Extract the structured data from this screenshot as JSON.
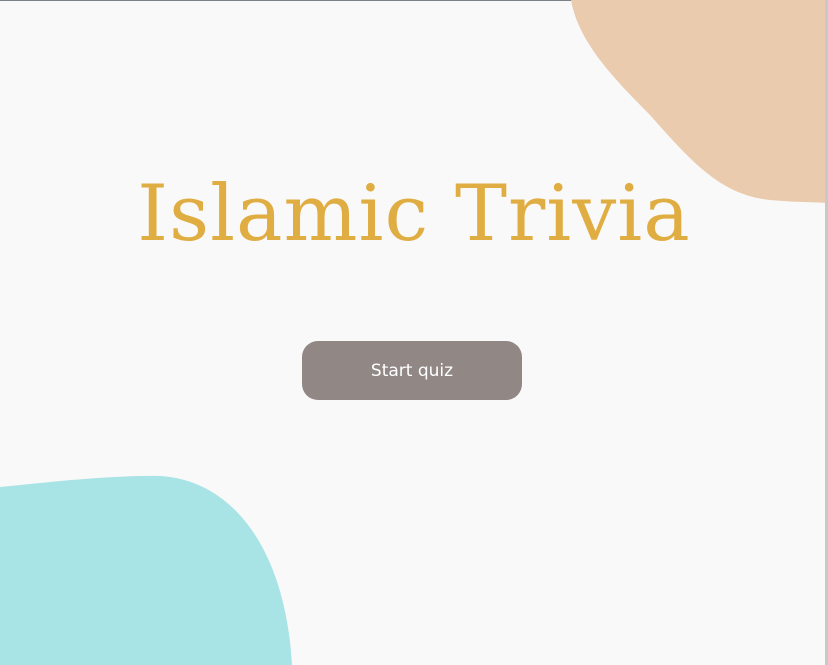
{
  "app": {
    "title": "Islamic Trivia",
    "start_button_label": "Start quiz"
  },
  "colors": {
    "background": "#f9f9f9",
    "title": "#e0ad42",
    "button_bg": "#918886",
    "button_text": "#ffffff",
    "blob_top_right": "#eacbae",
    "blob_bottom_left": "#a8e3e6"
  }
}
